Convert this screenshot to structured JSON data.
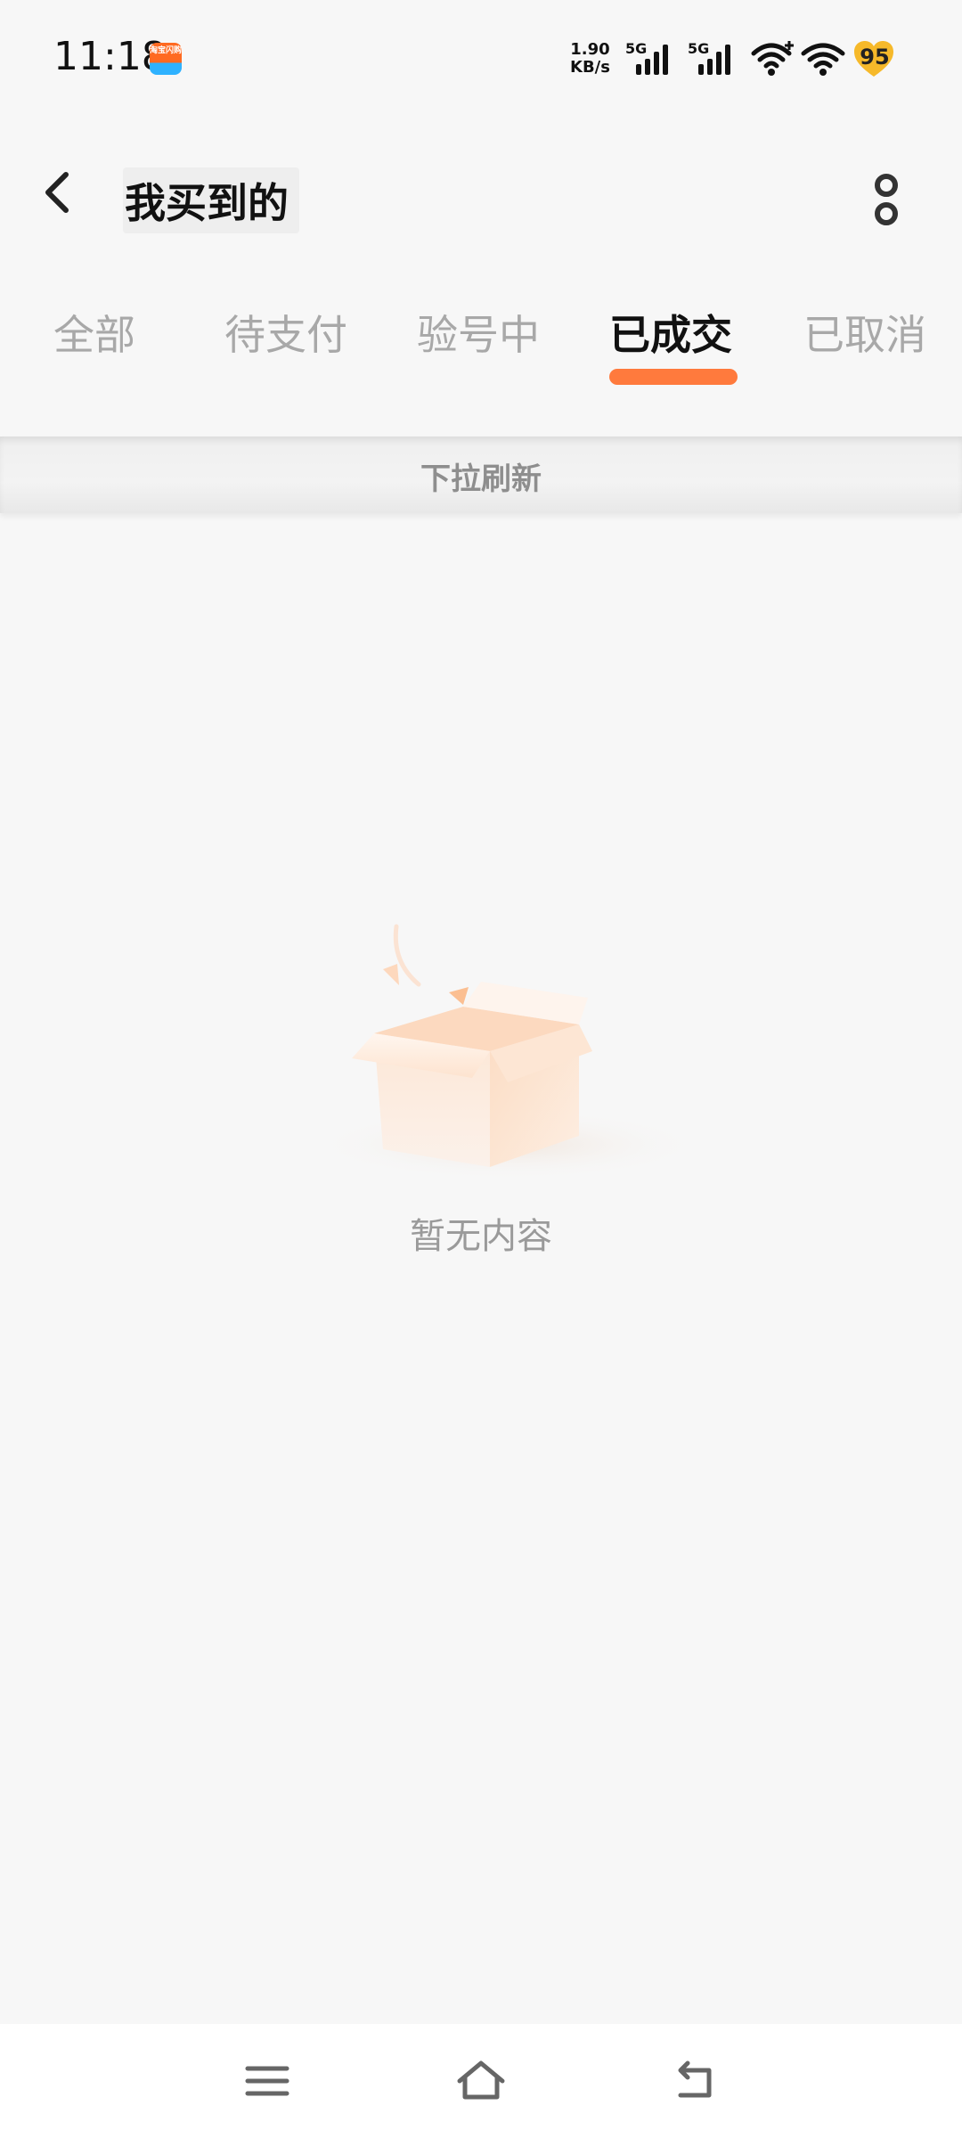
{
  "status_bar": {
    "time": "11:18",
    "app_badge": "淘宝闪购",
    "net_speed_value": "1.90",
    "net_speed_unit": "KB/s",
    "sim1_label": "5G",
    "sim2_label": "5G",
    "battery_level": "95",
    "icons": [
      "signal-icon",
      "signal-icon",
      "wifi-plus-icon",
      "wifi-icon",
      "battery-heart-icon"
    ]
  },
  "header": {
    "title": "我买到的",
    "back_icon": "chevron-left-icon",
    "more_icon": "more-vertical-icon"
  },
  "tabs": [
    {
      "label": "全部",
      "active": false
    },
    {
      "label": "待支付",
      "active": false
    },
    {
      "label": "验号中",
      "active": false
    },
    {
      "label": "已成交",
      "active": true
    },
    {
      "label": "已取消",
      "active": false
    }
  ],
  "refresh": {
    "label": "下拉刷新"
  },
  "empty_state": {
    "icon": "empty-box-icon",
    "label": "暂无内容"
  },
  "colors": {
    "accent": "#ff7a3d",
    "background": "#f7f7f7",
    "text_primary": "#111111",
    "text_secondary": "#a8a8a8"
  },
  "nav_bar": {
    "icons": [
      "menu-icon",
      "home-icon",
      "back-icon"
    ]
  }
}
